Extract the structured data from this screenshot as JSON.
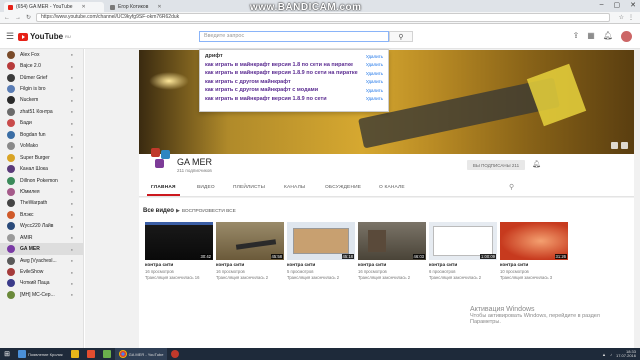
{
  "browser": {
    "tabs": [
      {
        "title": "(654) GA MER - YouTube",
        "active": true
      },
      {
        "title": "Егор Котиков",
        "active": false
      }
    ],
    "url": "https://www.youtube.com/channel/UC9kyfg9SF-okm76R62duk",
    "watermark": "www.BANDICAM.com"
  },
  "youtube": {
    "logo_text": "YouTube",
    "logo_region": "RU",
    "search_placeholder": "Введите запрос",
    "suggestions": [
      {
        "query": "дрифт",
        "delete_label": "Удалить"
      },
      {
        "query": "как играть в майнкрафт версия 1.8 по сети на пиратке",
        "delete_label": "Удалить"
      },
      {
        "query": "как играть в майнкрафт версия 1.8.9 по сети на пиратке",
        "delete_label": "Удалить"
      },
      {
        "query": "как играть с другом майнкрафт",
        "delete_label": "Удалить"
      },
      {
        "query": "как играть с другом майнкрафт с модами",
        "delete_label": "Удалить"
      },
      {
        "query": "как играть в майнкрафт версия 1.8.9 по сети",
        "delete_label": "Удалить"
      }
    ]
  },
  "sidebar": {
    "items": [
      {
        "label": "Alex Fox",
        "color": "#7a4b2a"
      },
      {
        "label": "Bajce 2.0",
        "color": "#b73b3b"
      },
      {
        "label": "Dûmer Grief",
        "color": "#3b3b3b"
      },
      {
        "label": "Filgin is bro",
        "color": "#5a7db5"
      },
      {
        "label": "Nuckem",
        "color": "#2a2a2a"
      },
      {
        "label": "zhat51 Контра",
        "color": "#6b6b6b"
      },
      {
        "label": "Бади",
        "color": "#c94b4b"
      },
      {
        "label": "Bogdan fun",
        "color": "#3b6ea5"
      },
      {
        "label": "VoMako",
        "color": "#8a8a8a"
      },
      {
        "label": "Super Burger",
        "color": "#d9a425"
      },
      {
        "label": "Канал Шокa",
        "color": "#5b3b7a"
      },
      {
        "label": "Dillnon Pokemon",
        "color": "#3b8a5a"
      },
      {
        "label": "Юмилея",
        "color": "#a55a8a"
      },
      {
        "label": "TheWarpath",
        "color": "#444"
      },
      {
        "label": "Влэкс",
        "color": "#d05a2a"
      },
      {
        "label": "Wycc220 Лайв",
        "color": "#2a4a7a"
      },
      {
        "label": "AMIR",
        "color": "#9a9a9a"
      },
      {
        "label": "GA MER",
        "color": "#7a3ba5",
        "active": true
      },
      {
        "label": "Awg [Vyachesl...",
        "color": "#5a5a5a"
      },
      {
        "label": "EvileShow",
        "color": "#a53b3b"
      },
      {
        "label": "Чоткий Паца",
        "color": "#3b3b8a"
      },
      {
        "label": "[МН] МС-Сер...",
        "color": "#6b8a3b"
      }
    ]
  },
  "channel": {
    "name": "GA MER",
    "subscribers": "211 подписчиков",
    "subscribed_label": "ВЫ ПОДПИСАНЫ",
    "subscribed_count": "211",
    "tabs": [
      "ГЛАВНАЯ",
      "ВИДЕО",
      "ПЛЕЙЛИСТЫ",
      "КАНАЛЫ",
      "ОБСУЖДЕНИЕ",
      "О КАНАЛЕ"
    ],
    "section_title": "Все видео",
    "play_all": "ВОСПРОИЗВЕСТИ ВСЕ"
  },
  "videos": [
    {
      "title": "контра сити",
      "duration": "30:42",
      "views": "16 просмотров",
      "status": "Трансляция закончилась 16"
    },
    {
      "title": "контра сити",
      "duration": "45:58",
      "views": "16 просмотров",
      "status": "Трансляция закончилась 2"
    },
    {
      "title": "контра сити",
      "duration": "45:18",
      "views": "5 просмотров",
      "status": "Трансляция закончилась 2"
    },
    {
      "title": "контра сити",
      "duration": "46:03",
      "views": "16 просмотров",
      "status": "Трансляция закончилась 2"
    },
    {
      "title": "контра сити",
      "duration": "1:00:09",
      "views": "6 просмотров",
      "status": "Трансляция закончилась 2"
    },
    {
      "title": "контра сити",
      "duration": "31:26",
      "views": "10 просмотров",
      "status": "Трансляция закончилась 3"
    }
  ],
  "windows_notice": {
    "title": "Активация Windows",
    "line1": "Чтобы активировать Windows, перейдите в раздел",
    "line2": "Параметры."
  },
  "taskbar": {
    "apps": [
      {
        "label": "Появление Кролик"
      },
      {
        "label": "GA MER - YouTube"
      }
    ],
    "time": "18:33",
    "date": "17.07.2016"
  }
}
